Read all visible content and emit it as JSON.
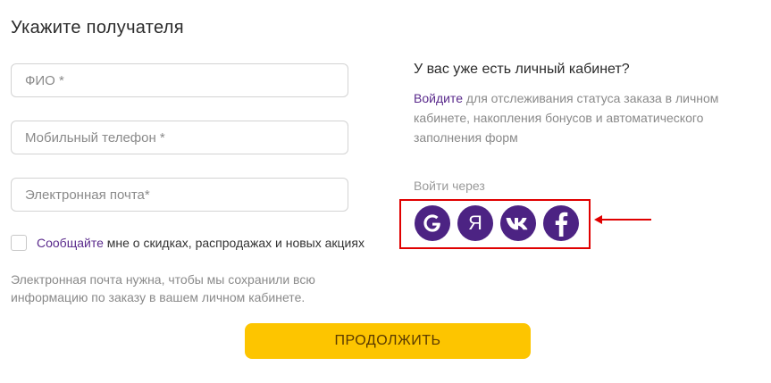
{
  "form": {
    "title": "Укажите получателя",
    "fio_placeholder": "ФИО *",
    "phone_placeholder": "Мобильный телефон *",
    "email_placeholder": "Электронная почта*",
    "subscribe_link": "Сообщайте",
    "subscribe_text": " мне о скидках, распродажах и новых акциях",
    "note": "Электронная почта нужна, чтобы мы сохранили всю информацию по заказу в вашем личном кабинете.",
    "continue_label": "ПРОДОЛЖИТЬ"
  },
  "login": {
    "title": "У вас уже есть личный кабинет?",
    "login_link": "Войдите",
    "description": " для отслеживания статуса заказа в личном кабинете, накопления бонусов и автоматического заполнения форм",
    "via_label": "Войти через",
    "social": [
      {
        "name": "google",
        "icon": "google-icon",
        "glyph": "G"
      },
      {
        "name": "yandex",
        "icon": "yandex-icon",
        "glyph": "Я"
      },
      {
        "name": "vk",
        "icon": "vk-icon",
        "glyph": "vk"
      },
      {
        "name": "facebook",
        "icon": "facebook-icon",
        "glyph": "f"
      }
    ]
  },
  "colors": {
    "accent": "#4c2383",
    "link": "#5a2a8c",
    "button": "#fdc500",
    "highlight": "#e00000"
  }
}
